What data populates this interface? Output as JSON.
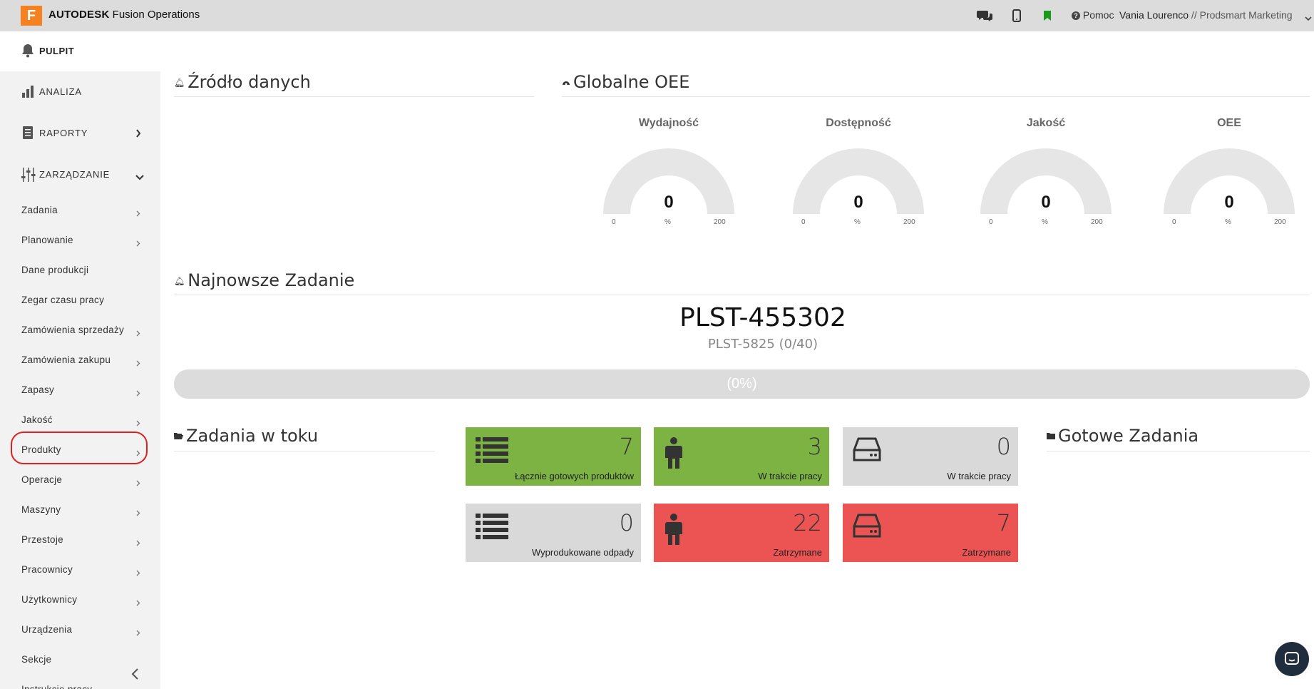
{
  "header": {
    "logo_letter": "F",
    "brand_strong": "AUTODESK",
    "brand_rest": " Fusion Operations",
    "help_label": "Pomoc",
    "user_name": "Vania Lourenco",
    "org_name": " // Prodsmart Marketing"
  },
  "sidebar": {
    "pulpit": "PULPIT",
    "analiza": "ANALIZA",
    "raporty": "RAPORTY",
    "zarzadzanie": "ZARZĄDZANIE",
    "items": [
      {
        "label": "Zadania",
        "chevron": true
      },
      {
        "label": "Planowanie",
        "chevron": true
      },
      {
        "label": "Dane produkcji",
        "chevron": false
      },
      {
        "label": "Zegar czasu pracy",
        "chevron": false
      },
      {
        "label": "Zamówienia sprzedaży",
        "chevron": true
      },
      {
        "label": "Zamówienia zakupu",
        "chevron": true
      },
      {
        "label": "Zapasy",
        "chevron": true
      },
      {
        "label": "Jakość",
        "chevron": true
      },
      {
        "label": "Produkty",
        "chevron": true
      },
      {
        "label": "Operacje",
        "chevron": true
      },
      {
        "label": "Maszyny",
        "chevron": true
      },
      {
        "label": "Przestoje",
        "chevron": true
      },
      {
        "label": "Pracownicy",
        "chevron": true
      },
      {
        "label": "Użytkownicy",
        "chevron": true
      },
      {
        "label": "Urządzenia",
        "chevron": true
      },
      {
        "label": "Sekcje",
        "chevron": false
      },
      {
        "label": "Instrukcje pracy",
        "chevron": false
      }
    ]
  },
  "main": {
    "zrodlo_title": "Źródło danych",
    "oee_title": "Globalne OEE",
    "gauges": [
      {
        "label": "Wydajność",
        "value": "0",
        "min": "0",
        "max": "200",
        "unit": "%"
      },
      {
        "label": "Dostępność",
        "value": "0",
        "min": "0",
        "max": "200",
        "unit": "%"
      },
      {
        "label": "Jakość",
        "value": "0",
        "min": "0",
        "max": "200",
        "unit": "%"
      },
      {
        "label": "OEE",
        "value": "0",
        "min": "0",
        "max": "200",
        "unit": "%"
      }
    ],
    "latest_title": "Najnowsze Zadanie",
    "latest_job_id": "PLST-455302",
    "latest_job_sub": "PLST-5825 (0/40)",
    "latest_progress_text": "(0%)",
    "latest_progress_fraction": 0,
    "in_progress_title": "Zadania w toku",
    "done_title": "Gotowe Zadania",
    "tiles": [
      {
        "value": "7",
        "caption": "Łącznie gotowych produktów",
        "color": "#7cb342",
        "icon": "list-icon"
      },
      {
        "value": "3",
        "caption": "W trakcie pracy",
        "color": "#7cb342",
        "icon": "worker-icon"
      },
      {
        "value": "0",
        "caption": "W trakcie pracy",
        "color": "#d9d9d9",
        "icon": "machine-icon"
      },
      {
        "value": "0",
        "caption": "Wyprodukowane odpady",
        "color": "#d9d9d9",
        "icon": "list-icon"
      },
      {
        "value": "22",
        "caption": "Zatrzymane",
        "color": "#ec5353",
        "icon": "worker-icon"
      },
      {
        "value": "7",
        "caption": "Zatrzymane",
        "color": "#ec5353",
        "icon": "machine-icon"
      }
    ]
  },
  "colors": {
    "accent_orange": "#f58220",
    "green": "#7cb342",
    "red": "#ec5353",
    "grey": "#d9d9d9"
  }
}
